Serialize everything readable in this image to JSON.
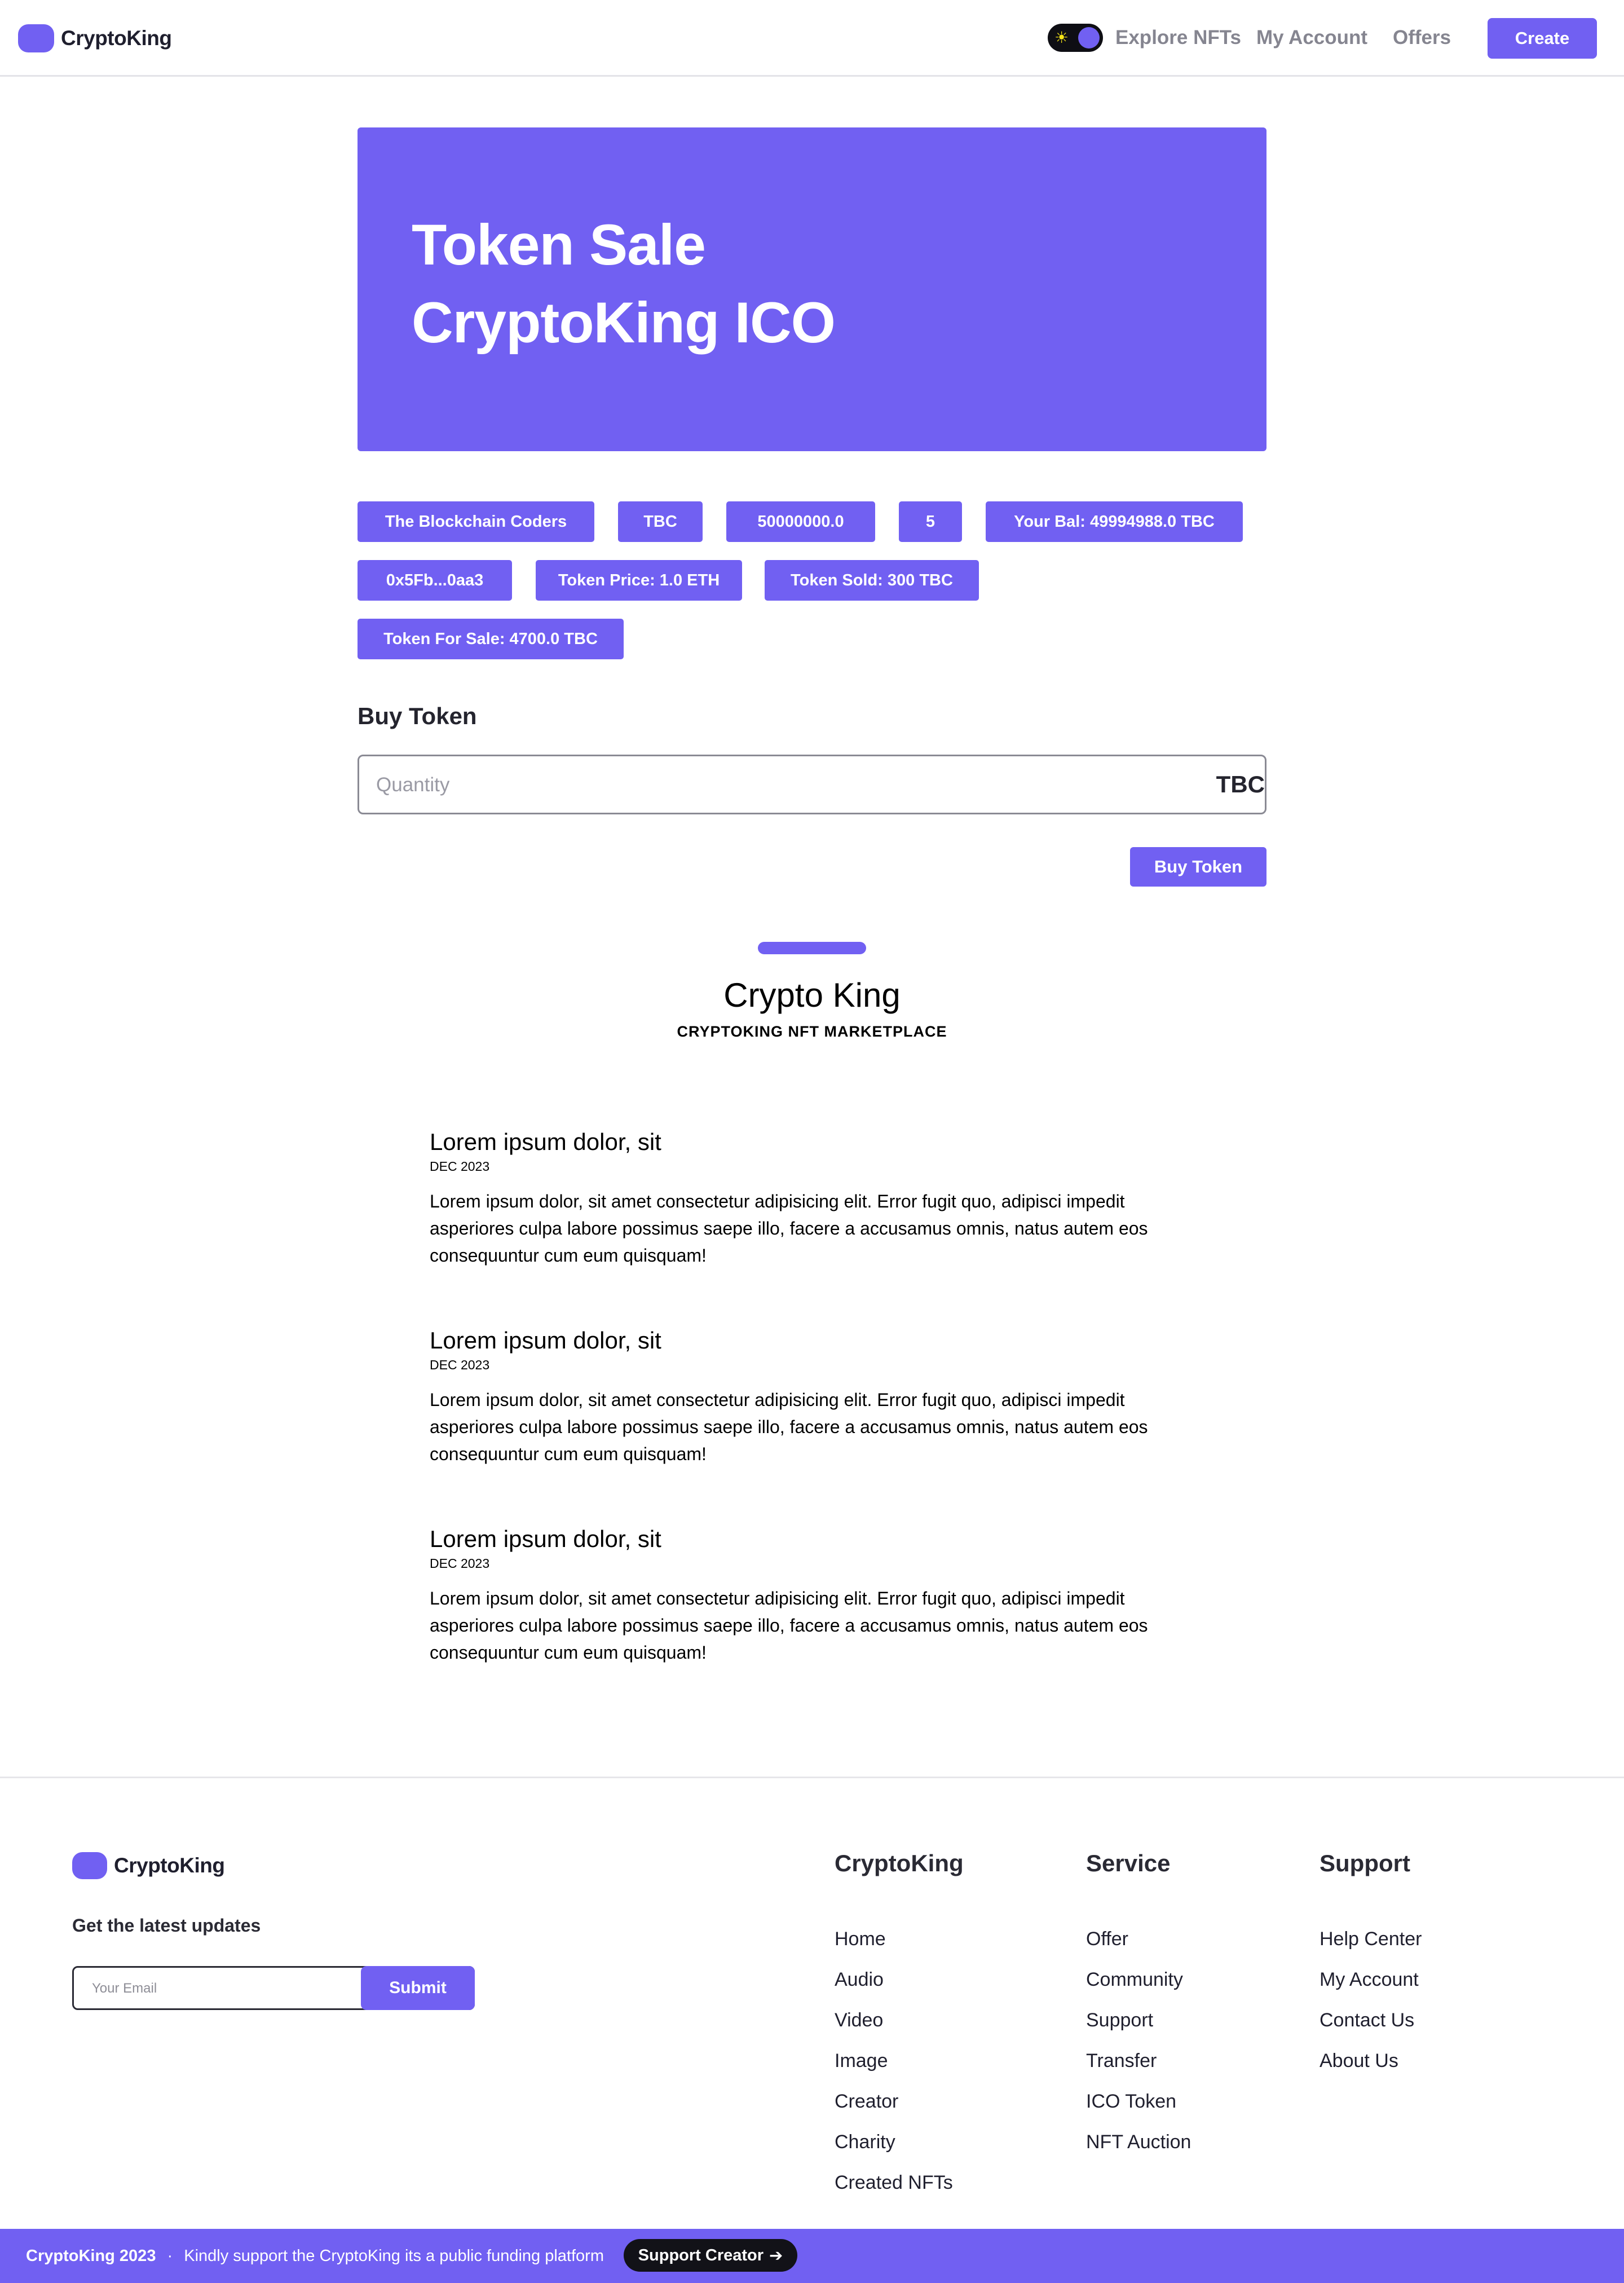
{
  "colors": {
    "accent": "#7160f2",
    "text": "#1f1f2e",
    "muted": "#858590"
  },
  "navbar": {
    "brand": "CryptoKing",
    "links": [
      "Explore NFTs",
      "My Account",
      "Offers"
    ],
    "create_label": "Create",
    "theme_icon": "sun-icon"
  },
  "hero": {
    "line1": "Token Sale",
    "line2": "CryptoKing ICO"
  },
  "badges": {
    "owner": "The Blockchain Coders",
    "symbol": "TBC",
    "supply": "50000000.0",
    "decimals": "5",
    "balance": "Your Bal: 49994988.0 TBC",
    "address": "0x5Fb...0aa3",
    "price": "Token Price: 1.0 ETH",
    "sold": "Token Sold: 300 TBC",
    "for_sale": "Token For Sale: 4700.0 TBC"
  },
  "buy": {
    "title": "Buy Token",
    "placeholder": "Quantity",
    "unit": "TBC",
    "button": "Buy Token"
  },
  "section": {
    "title": "Crypto King",
    "subtitle": "CRYPTOKING NFT MARKETPLACE"
  },
  "posts": [
    {
      "title": "Lorem ipsum dolor, sit",
      "date": "DEC 2023",
      "body": "Lorem ipsum dolor, sit amet consectetur adipisicing elit. Error fugit quo, adipisci impedit asperiores culpa labore possimus saepe illo, facere a accusamus omnis, natus autem eos consequuntur cum eum quisquam!"
    },
    {
      "title": "Lorem ipsum dolor, sit",
      "date": "DEC 2023",
      "body": "Lorem ipsum dolor, sit amet consectetur adipisicing elit. Error fugit quo, adipisci impedit asperiores culpa labore possimus saepe illo, facere a accusamus omnis, natus autem eos consequuntur cum eum quisquam!"
    },
    {
      "title": "Lorem ipsum dolor, sit",
      "date": "DEC 2023",
      "body": "Lorem ipsum dolor, sit amet consectetur adipisicing elit. Error fugit quo, adipisci impedit asperiores culpa labore possimus saepe illo, facere a accusamus omnis, natus autem eos consequuntur cum eum quisquam!"
    }
  ],
  "footer": {
    "brand": "CryptoKing",
    "updates_label": "Get the latest updates",
    "email_placeholder": "Your Email",
    "submit_label": "Submit",
    "columns": [
      {
        "heading": "CryptoKing",
        "links": [
          "Home",
          "Audio",
          "Video",
          "Image",
          "Creator",
          "Charity",
          "Created NFTs"
        ]
      },
      {
        "heading": "Service",
        "links": [
          "Offer",
          "Community",
          "Support",
          "Transfer",
          "ICO Token",
          "NFT Auction"
        ]
      },
      {
        "heading": "Support",
        "links": [
          "Help Center",
          "My Account",
          "Contact Us",
          "About Us"
        ]
      }
    ]
  },
  "bottom_bar": {
    "copyright": "CryptoKing 2023",
    "separator": "·",
    "message": "Kindly support the CryptoKing its a public funding platform",
    "button": "Support Creator",
    "button_icon": "arrow-right-icon"
  }
}
